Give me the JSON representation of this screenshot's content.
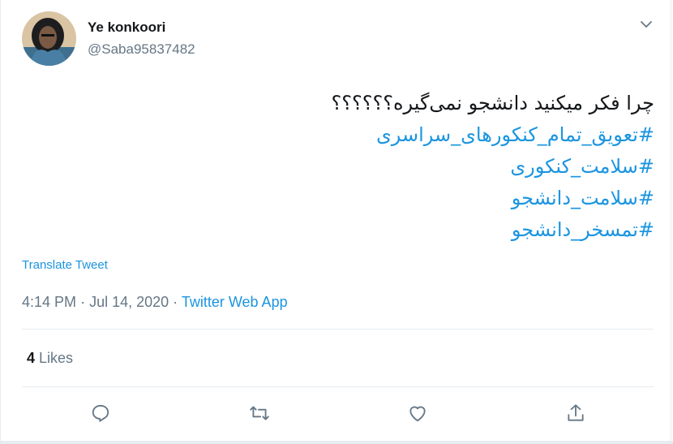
{
  "user": {
    "display_name": "Ye konkoori",
    "handle": "@Saba95837482"
  },
  "tweet": {
    "text": "چرا فکر میکنید دانشجو نمی‌گیره؟؟؟؟؟؟",
    "hashtags": [
      "#تعویق_تمام_کنکورهای_سراسری",
      "#سلامت_کنکوری",
      "#سلامت_دانشجو",
      "#تمسخر_دانشجو"
    ],
    "translate_label": "Translate Tweet"
  },
  "meta": {
    "time": "4:14 PM",
    "separator1": "·",
    "date": "Jul 14, 2020",
    "separator2": "·",
    "source": "Twitter Web App"
  },
  "stats": {
    "likes_count": "4",
    "likes_label": "Likes"
  },
  "icons": {
    "caret": "chevron-down-icon",
    "reply": "reply-icon",
    "retweet": "retweet-icon",
    "like": "heart-icon",
    "share": "share-icon"
  },
  "colors": {
    "accent": "#1b95e0",
    "secondary_text": "#657786",
    "primary_text": "#14171a",
    "divider": "#e6ecf0"
  }
}
